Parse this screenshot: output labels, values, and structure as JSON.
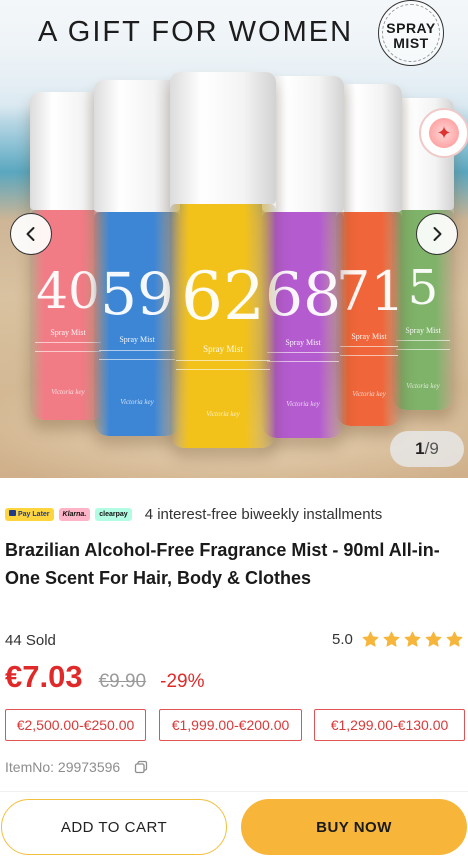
{
  "hero": {
    "title": "A GIFT FOR WOMEN",
    "badge_line1": "SPRAY",
    "badge_line2": "MIST",
    "counter_current": "1",
    "counter_separator": "/",
    "counter_total": "9",
    "bottles": [
      {
        "number": "40",
        "label": "Spray Mist",
        "color": "#f27c86",
        "brand": "Victoria key"
      },
      {
        "number": "59",
        "label": "Spray Mist",
        "color": "#3d86d6",
        "brand": "Victoria key"
      },
      {
        "number": "62",
        "label": "Spray Mist",
        "color": "#f2c21a",
        "brand": "Victoria key"
      },
      {
        "number": "68",
        "label": "Spray Mist",
        "color": "#b45bd0",
        "brand": "Victoria key"
      },
      {
        "number": "71",
        "label": "Spray Mist",
        "color": "#f0663a",
        "brand": "Victoria key"
      },
      {
        "number": "5",
        "label": "Spray Mist",
        "color": "#7fb36a",
        "brand": "Victoria key"
      }
    ]
  },
  "payment": {
    "badges": [
      "Pay Later",
      "Klarna.",
      "clearpay"
    ],
    "installments_text": "4 interest-free biweekly installments"
  },
  "product": {
    "title": "Brazilian Alcohol-Free Fragrance Mist - 90ml All-in-One Scent For Hair, Body & Clothes",
    "sold": "44 Sold",
    "rating": "5.0",
    "stars": 5,
    "price": "€7.03",
    "original_price": "€9.90",
    "discount": "-29%",
    "tiers": [
      "€2,500.00-€250.00",
      "€1,999.00-€200.00",
      "€1,299.00-€130.00"
    ],
    "item_no": "ItemNo: 29973596"
  },
  "actions": {
    "add_to_cart": "ADD TO CART",
    "buy_now": "BUY NOW"
  },
  "colors": {
    "price_red": "#e02a2a",
    "star_gold": "#f6b53b",
    "buy_orange": "#f7b63a"
  }
}
